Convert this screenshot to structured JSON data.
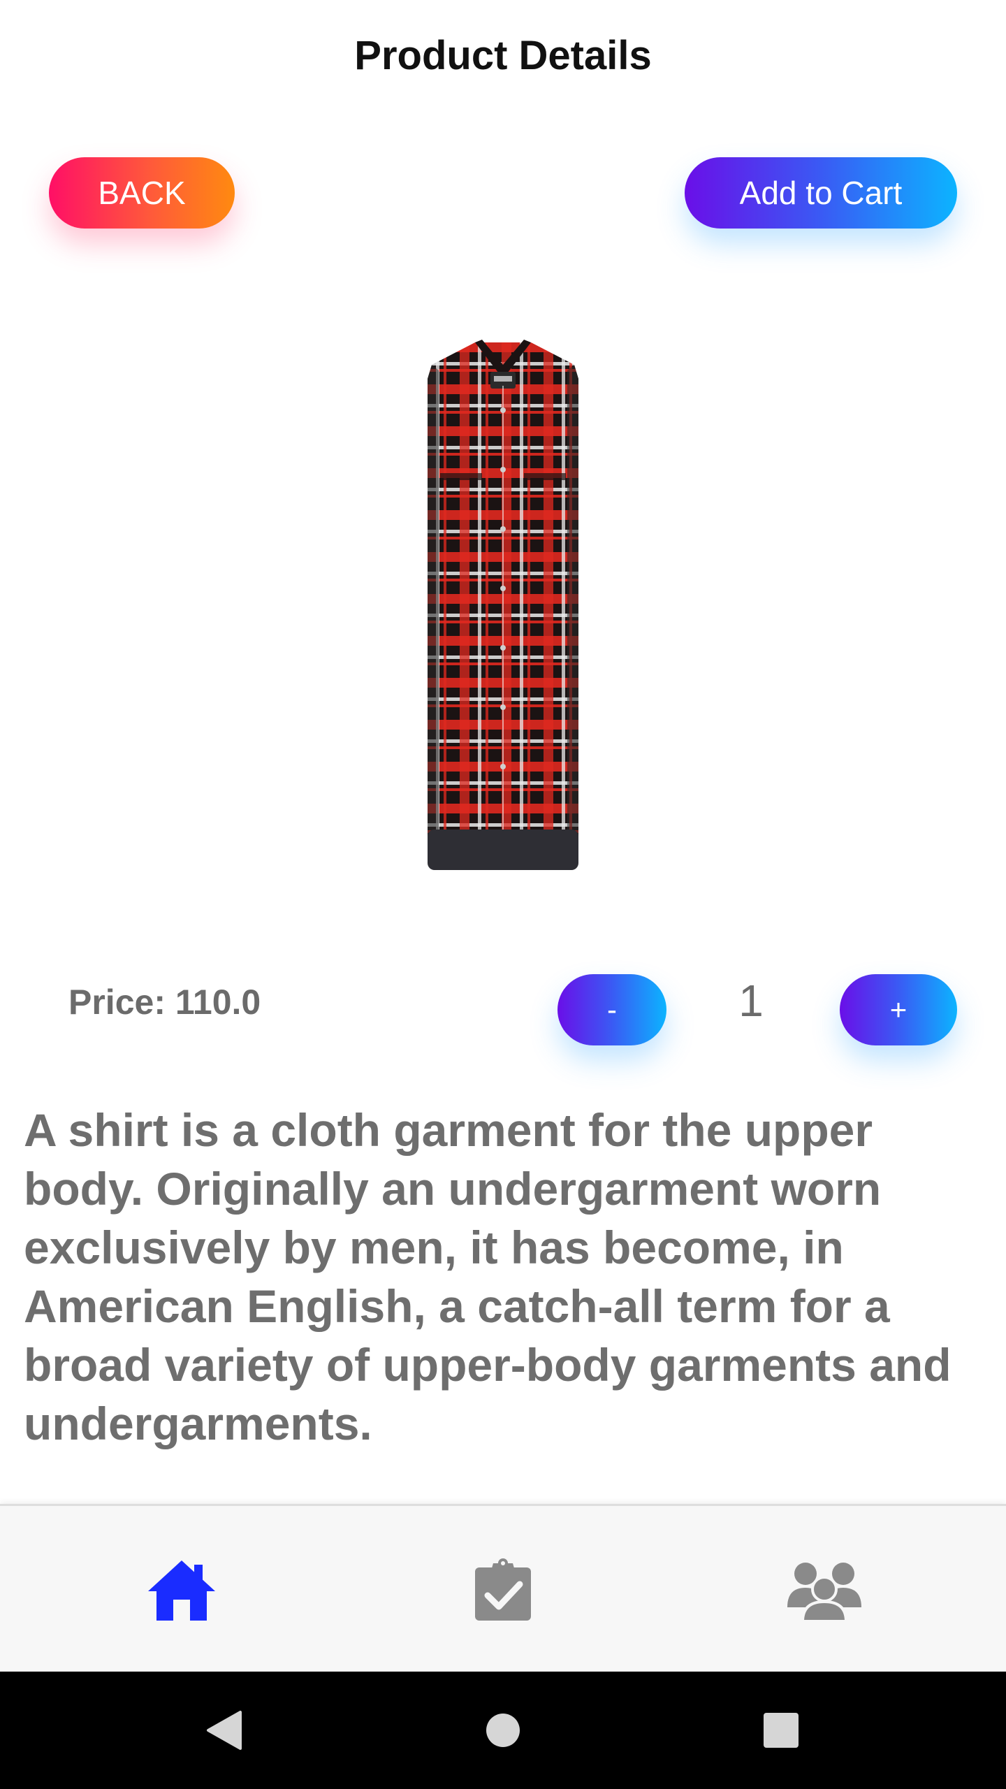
{
  "header": {
    "title": "Product Details"
  },
  "actions": {
    "back_label": "BACK",
    "add_to_cart_label": "Add to Cart"
  },
  "product": {
    "image_icon": "plaid-shirt-image",
    "price_text": "Price: 110.0",
    "description": "A shirt is a cloth garment for the upper body. Originally an undergarment worn exclusively by men, it has become, in American English, a catch-all term for a broad variety of upper-body garments and undergarments."
  },
  "quantity": {
    "decrement_label": "-",
    "value": "1",
    "increment_label": "+"
  },
  "bottom_nav": {
    "items": [
      {
        "icon": "home-icon",
        "active": true
      },
      {
        "icon": "clipboard-check-icon",
        "active": false
      },
      {
        "icon": "users-icon",
        "active": false
      }
    ]
  },
  "system_nav": {
    "items": [
      {
        "icon": "back-triangle-icon"
      },
      {
        "icon": "home-circle-icon"
      },
      {
        "icon": "recents-square-icon"
      }
    ]
  },
  "colors": {
    "accent_active": "#1a2cff",
    "icon_inactive": "#8a8a8a",
    "back_gradient": [
      "#ff0f66",
      "#ff8a10"
    ],
    "primary_gradient": [
      "#6a0fe8",
      "#0cb4ff"
    ]
  }
}
